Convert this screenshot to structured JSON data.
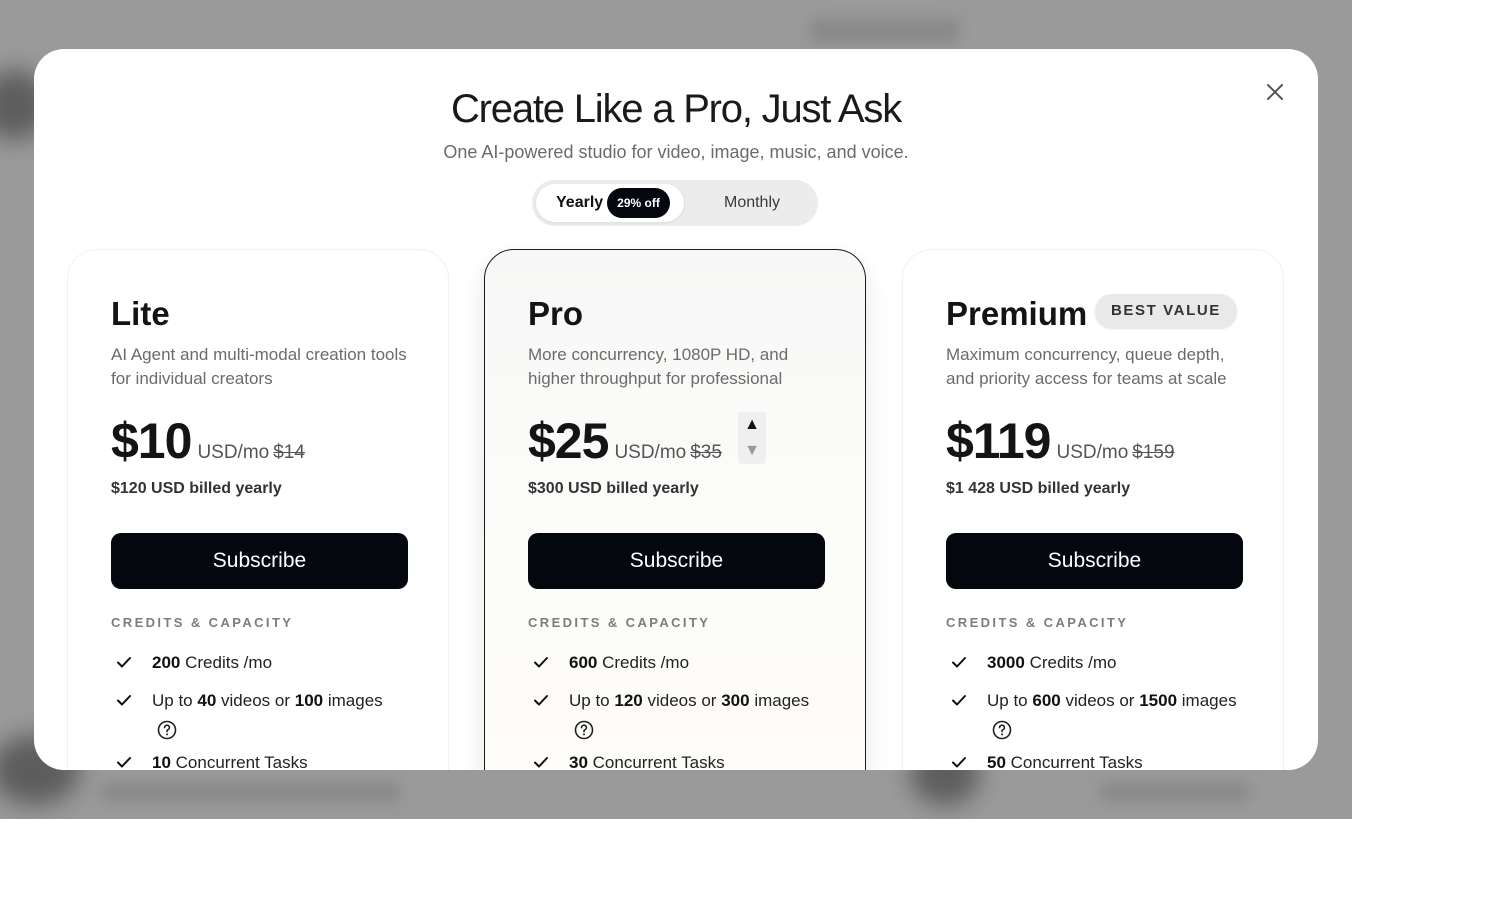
{
  "modal": {
    "title": "Create Like a Pro, Just Ask",
    "subtitle": "One AI-powered studio for video, image, music, and voice.",
    "close_icon": "close-icon"
  },
  "billing_toggle": {
    "yearly_label": "Yearly",
    "discount_badge": "29% off",
    "monthly_label": "Monthly",
    "selected": "Yearly"
  },
  "plans": [
    {
      "name": "Lite",
      "badge": "",
      "description": "AI Agent and multi-modal creation tools for individual creators",
      "price": "$10",
      "per": "USD/mo",
      "old_price": "$14",
      "billed": "$120 USD billed yearly",
      "subscribe_label": "Subscribe",
      "section_label": "CREDITS & CAPACITY",
      "features": {
        "credits": {
          "value": "200",
          "suffix": "Credits /mo"
        },
        "media": {
          "prefix": "Up to",
          "videos": "40",
          "middle": "videos or",
          "images": "100",
          "suffix": "images"
        },
        "tasks": {
          "value": "10",
          "suffix": "Concurrent Tasks"
        }
      }
    },
    {
      "name": "Pro",
      "badge": "",
      "description": "More concurrency, 1080P HD, and higher throughput for professional",
      "price": "$25",
      "per": "USD/mo",
      "old_price": "$35",
      "billed": "$300 USD billed yearly",
      "subscribe_label": "Subscribe",
      "section_label": "CREDITS & CAPACITY",
      "stepper": {
        "up_icon": "triangle-up-icon",
        "down_icon": "triangle-down-icon"
      },
      "features": {
        "credits": {
          "value": "600",
          "suffix": "Credits /mo"
        },
        "media": {
          "prefix": "Up to",
          "videos": "120",
          "middle": "videos or",
          "images": "300",
          "suffix": "images"
        },
        "tasks": {
          "value": "30",
          "suffix": "Concurrent Tasks"
        }
      }
    },
    {
      "name": "Premium",
      "badge": "BEST VALUE",
      "description": "Maximum concurrency, queue depth, and priority access for teams at scale",
      "price": "$119",
      "per": "USD/mo",
      "old_price": "$159",
      "billed": "$1 428 USD billed yearly",
      "subscribe_label": "Subscribe",
      "section_label": "CREDITS & CAPACITY",
      "features": {
        "credits": {
          "value": "3000",
          "suffix": "Credits /mo"
        },
        "media": {
          "prefix": "Up to",
          "videos": "600",
          "middle": "videos or",
          "images": "1500",
          "suffix": "images"
        },
        "tasks": {
          "value": "50",
          "suffix": "Concurrent Tasks"
        }
      }
    }
  ],
  "icons": {
    "check": "check-icon",
    "help": "question-circle-icon"
  },
  "colors": {
    "button": "#05070f",
    "backdrop": "#9a9a9a",
    "featured_border": "#1b1b1b"
  }
}
